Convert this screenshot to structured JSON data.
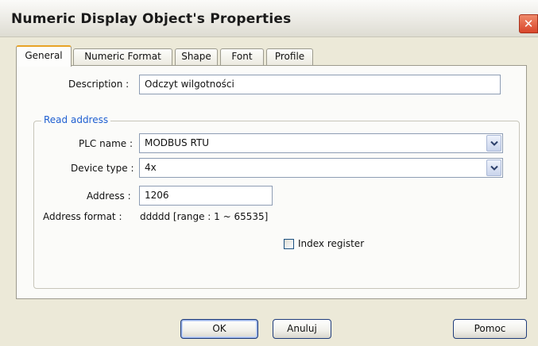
{
  "window": {
    "title": "Numeric Display Object's Properties",
    "close_glyph": "✕"
  },
  "tabs": [
    {
      "label": "General",
      "active": true
    },
    {
      "label": "Numeric Format",
      "active": false
    },
    {
      "label": "Shape",
      "active": false
    },
    {
      "label": "Font",
      "active": false
    },
    {
      "label": "Profile",
      "active": false
    }
  ],
  "general": {
    "description_label": "Description :",
    "description_value": "Odczyt wilgotności",
    "read_address": {
      "group_title": "Read address",
      "plc_name_label": "PLC name :",
      "plc_name_value": "MODBUS RTU",
      "device_type_label": "Device type :",
      "device_type_value": "4x",
      "address_label": "Address :",
      "address_value": "1206",
      "address_format_label": "Address format :",
      "address_format_value": "ddddd [range : 1 ~ 65535]",
      "index_register_label": "Index register",
      "index_register_checked": false
    }
  },
  "buttons": {
    "ok": "OK",
    "cancel": "Anuluj",
    "help": "Pomoc"
  },
  "colors": {
    "accent_tab": "#e8a326",
    "group_title": "#1f5fd1",
    "close": "#d8452a"
  },
  "icons": {
    "close": "close-icon",
    "dropdown": "chevron-down-icon"
  }
}
